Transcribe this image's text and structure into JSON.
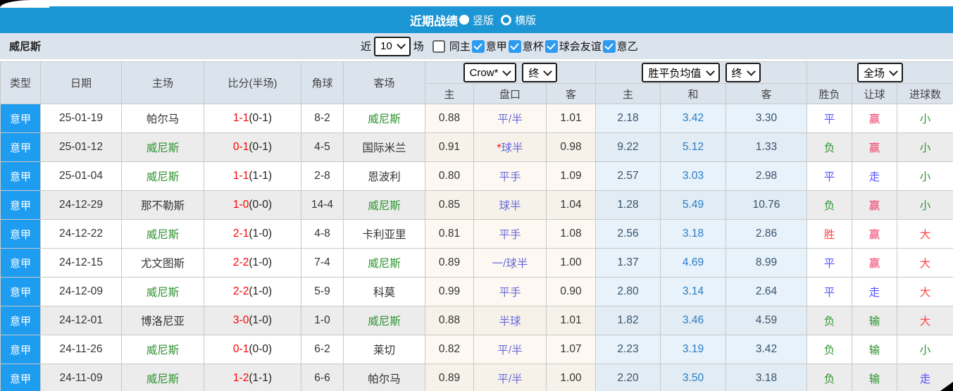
{
  "titlebar": {
    "title": "近期战绩",
    "options": [
      {
        "label": "竖版",
        "selected": true
      },
      {
        "label": "横版",
        "selected": false
      }
    ]
  },
  "filterbar": {
    "team": "威尼斯",
    "near": "近",
    "rounds": "10",
    "matches": "场",
    "checkboxes": [
      {
        "label": "同主",
        "checked": false
      },
      {
        "label": "意甲",
        "checked": true
      },
      {
        "label": "意杯",
        "checked": true
      },
      {
        "label": "球会友谊",
        "checked": true
      },
      {
        "label": "意乙",
        "checked": true
      }
    ]
  },
  "colors": {
    "accent_blue": "#1b95d3",
    "league_cell_blue": "#1e9cf0",
    "team_green": "#2f9331",
    "score_red": "#ff0000",
    "win_red": "#ff4545",
    "draw_blue": "#5353ff",
    "lose_green": "#2f9331",
    "handicap_violet": "#6a6ada"
  },
  "table": {
    "main_headers": [
      "类型",
      "日期",
      "主场",
      "比分(半场)",
      "角球",
      "客场"
    ],
    "odds_group": {
      "company": "Crow*",
      "state": "终",
      "cols": [
        "主",
        "盘口",
        "客"
      ]
    },
    "avg_group": {
      "label": "胜平负均值",
      "state": "终",
      "cols": [
        "主",
        "和",
        "客"
      ]
    },
    "result_group": {
      "scope": "全场",
      "cols": [
        "胜负",
        "让球",
        "进球数"
      ]
    },
    "rows": [
      {
        "league": "意甲",
        "date": "25-01-19",
        "home": "帕尔马",
        "score": "1-1",
        "half": "(0-1)",
        "corner": "8-2",
        "away": "威尼斯",
        "odds_home": "0.88",
        "handicap": "平/半",
        "handicap_star": false,
        "odds_away": "1.01",
        "avg_home": "2.18",
        "avg_draw": "3.42",
        "avg_away": "3.30",
        "outcome": "平",
        "handicap_outcome": "赢",
        "goals_outcome": "小",
        "shaded": false
      },
      {
        "league": "意甲",
        "date": "25-01-12",
        "home": "威尼斯",
        "score": "0-1",
        "half": "(0-1)",
        "corner": "4-5",
        "away": "国际米兰",
        "odds_home": "0.91",
        "handicap": "球半",
        "handicap_star": true,
        "odds_away": "0.98",
        "avg_home": "9.22",
        "avg_draw": "5.12",
        "avg_away": "1.33",
        "outcome": "负",
        "handicap_outcome": "赢",
        "goals_outcome": "小",
        "shaded": true
      },
      {
        "league": "意甲",
        "date": "25-01-04",
        "home": "威尼斯",
        "score": "1-1",
        "half": "(1-1)",
        "corner": "2-8",
        "away": "恩波利",
        "odds_home": "0.80",
        "handicap": "平手",
        "handicap_star": false,
        "odds_away": "1.09",
        "avg_home": "2.57",
        "avg_draw": "3.03",
        "avg_away": "2.98",
        "outcome": "平",
        "handicap_outcome": "走",
        "goals_outcome": "小",
        "shaded": false
      },
      {
        "league": "意甲",
        "date": "24-12-29",
        "home": "那不勒斯",
        "score": "1-0",
        "half": "(0-0)",
        "corner": "14-4",
        "away": "威尼斯",
        "odds_home": "0.85",
        "handicap": "球半",
        "handicap_star": false,
        "odds_away": "1.04",
        "avg_home": "1.28",
        "avg_draw": "5.49",
        "avg_away": "10.76",
        "outcome": "负",
        "handicap_outcome": "赢",
        "goals_outcome": "小",
        "shaded": true
      },
      {
        "league": "意甲",
        "date": "24-12-22",
        "home": "威尼斯",
        "score": "2-1",
        "half": "(1-0)",
        "corner": "4-8",
        "away": "卡利亚里",
        "odds_home": "0.81",
        "handicap": "平手",
        "handicap_star": false,
        "odds_away": "1.08",
        "avg_home": "2.56",
        "avg_draw": "3.18",
        "avg_away": "2.86",
        "outcome": "胜",
        "handicap_outcome": "赢",
        "goals_outcome": "大",
        "shaded": false
      },
      {
        "league": "意甲",
        "date": "24-12-15",
        "home": "尤文图斯",
        "score": "2-2",
        "half": "(1-0)",
        "corner": "7-4",
        "away": "威尼斯",
        "odds_home": "0.89",
        "handicap": "一/球半",
        "handicap_star": false,
        "odds_away": "1.00",
        "avg_home": "1.37",
        "avg_draw": "4.69",
        "avg_away": "8.99",
        "outcome": "平",
        "handicap_outcome": "赢",
        "goals_outcome": "大",
        "shaded": false
      },
      {
        "league": "意甲",
        "date": "24-12-09",
        "home": "威尼斯",
        "score": "2-2",
        "half": "(1-0)",
        "corner": "5-9",
        "away": "科莫",
        "odds_home": "0.99",
        "handicap": "平手",
        "handicap_star": false,
        "odds_away": "0.90",
        "avg_home": "2.80",
        "avg_draw": "3.14",
        "avg_away": "2.64",
        "outcome": "平",
        "handicap_outcome": "走",
        "goals_outcome": "大",
        "shaded": false
      },
      {
        "league": "意甲",
        "date": "24-12-01",
        "home": "博洛尼亚",
        "score": "3-0",
        "half": "(1-0)",
        "corner": "1-0",
        "away": "威尼斯",
        "odds_home": "0.88",
        "handicap": "半球",
        "handicap_star": false,
        "odds_away": "1.01",
        "avg_home": "1.82",
        "avg_draw": "3.46",
        "avg_away": "4.59",
        "outcome": "负",
        "handicap_outcome": "输",
        "goals_outcome": "大",
        "shaded": true
      },
      {
        "league": "意甲",
        "date": "24-11-26",
        "home": "威尼斯",
        "score": "0-1",
        "half": "(0-0)",
        "corner": "6-2",
        "away": "莱切",
        "odds_home": "0.82",
        "handicap": "平/半",
        "handicap_star": false,
        "odds_away": "1.07",
        "avg_home": "2.23",
        "avg_draw": "3.19",
        "avg_away": "3.42",
        "outcome": "负",
        "handicap_outcome": "输",
        "goals_outcome": "小",
        "shaded": false
      },
      {
        "league": "意甲",
        "date": "24-11-09",
        "home": "威尼斯",
        "score": "1-2",
        "half": "(1-1)",
        "corner": "6-6",
        "away": "帕尔马",
        "odds_home": "0.89",
        "handicap": "平/半",
        "handicap_star": false,
        "odds_away": "1.00",
        "avg_home": "2.20",
        "avg_draw": "3.50",
        "avg_away": "3.18",
        "outcome": "负",
        "handicap_outcome": "输",
        "goals_outcome": "走",
        "shaded": true
      }
    ]
  }
}
